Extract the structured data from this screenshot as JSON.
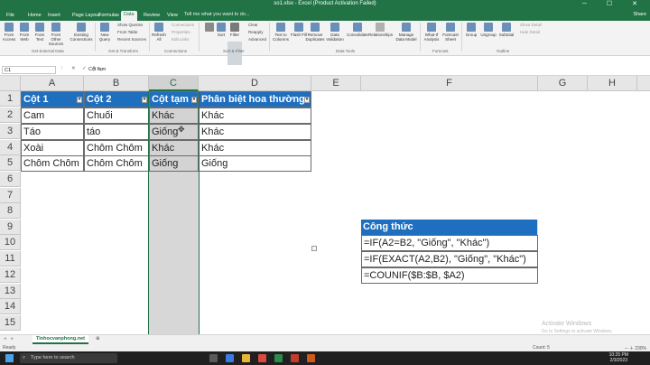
{
  "window": {
    "title": "so1.xlsx - Excel (Product Activation Failed)",
    "controls": "─ ☐ ✕"
  },
  "ribbon_tabs": [
    "File",
    "Home",
    "Insert",
    "Page Layout",
    "Formulas",
    "Data",
    "Review",
    "View"
  ],
  "active_tab": "Data",
  "tell_me": "Tell me what you want to do...",
  "share": "Share",
  "ribbon": {
    "get_external": {
      "buttons": [
        "From Access",
        "From Web",
        "From Text",
        "From Other Sources",
        "Existing Connections"
      ],
      "label": "Get External Data"
    },
    "get_transform": {
      "new_query": "New Query",
      "items": [
        "Show Queries",
        "From Table",
        "Recent Sources"
      ],
      "label": "Get & Transform"
    },
    "connections": {
      "refresh": "Refresh All",
      "items": [
        "Connections",
        "Properties",
        "Edit Links"
      ],
      "label": "Connections"
    },
    "sort_filter": {
      "sort": "Sort",
      "filter": "Filter",
      "items": [
        "Clear",
        "Reapply",
        "Advanced"
      ],
      "label": "Sort & Filter"
    },
    "data_tools": {
      "buttons": [
        "Text to Columns",
        "Flash Fill",
        "Remove Duplicates",
        "Data Validation",
        "Consolidate",
        "Relationships",
        "Manage Data Model"
      ],
      "label": "Data Tools"
    },
    "forecast": {
      "buttons": [
        "What-If Analysis",
        "Forecast Sheet"
      ],
      "label": "Forecast"
    },
    "outline": {
      "buttons": [
        "Group",
        "Ungroup",
        "Subtotal"
      ],
      "items": [
        "Show Detail",
        "Hide Detail"
      ],
      "label": "Outline"
    }
  },
  "formula_bar": {
    "name_box": "C1",
    "icons": "⋮ ✕ ✓ fx",
    "content": "Cột tạm"
  },
  "columns": [
    "A",
    "B",
    "C",
    "D",
    "E",
    "F",
    "G",
    "H"
  ],
  "selected_column": "C",
  "rows": [
    "1",
    "2",
    "3",
    "4",
    "5",
    "6",
    "7",
    "8",
    "9",
    "10",
    "11",
    "12",
    "13",
    "14",
    "15"
  ],
  "table": {
    "headers": [
      "Cột 1",
      "Cột 2",
      "Cột tạm",
      "Phân biệt hoa thường"
    ],
    "filter_glyph": "▾",
    "data": [
      [
        "Cam",
        "Chuối",
        "Khác",
        "Khác"
      ],
      [
        "Táo",
        "táo",
        "Giống",
        "Khác"
      ],
      [
        "Xoài",
        "Chôm Chôm",
        "Khác",
        "Khác"
      ],
      [
        "Chôm Chôm",
        "Chôm Chôm",
        "Giống",
        "Giống"
      ]
    ]
  },
  "formulas_box": {
    "header": "Công thức",
    "lines": [
      "=IF(A2=B2, \"Giống\", \"Khác\")",
      "=IF(EXACT(A2,B2), \"Giống\", \"Khác\")",
      "=COUNIF($B:$B, $A2)"
    ]
  },
  "sheet_tab": "Tinhocvanphong.net",
  "sheet_nav": "◂ ▸",
  "add_sheet": "⊕",
  "status": {
    "ready": "Ready",
    "count": "Count: 5",
    "zoom": "─ ＋ 230%"
  },
  "watermark": {
    "line1": "Activate Windows",
    "line2": "Go to Settings to activate Windows."
  },
  "taskbar": {
    "search_placeholder": "Type here to search",
    "time": "10:25 PM",
    "date": "2/3/2023"
  },
  "colors": {
    "excel_green": "#217346",
    "table_header_blue": "#1f6fc1",
    "selected_gray": "#d3d3d3"
  }
}
